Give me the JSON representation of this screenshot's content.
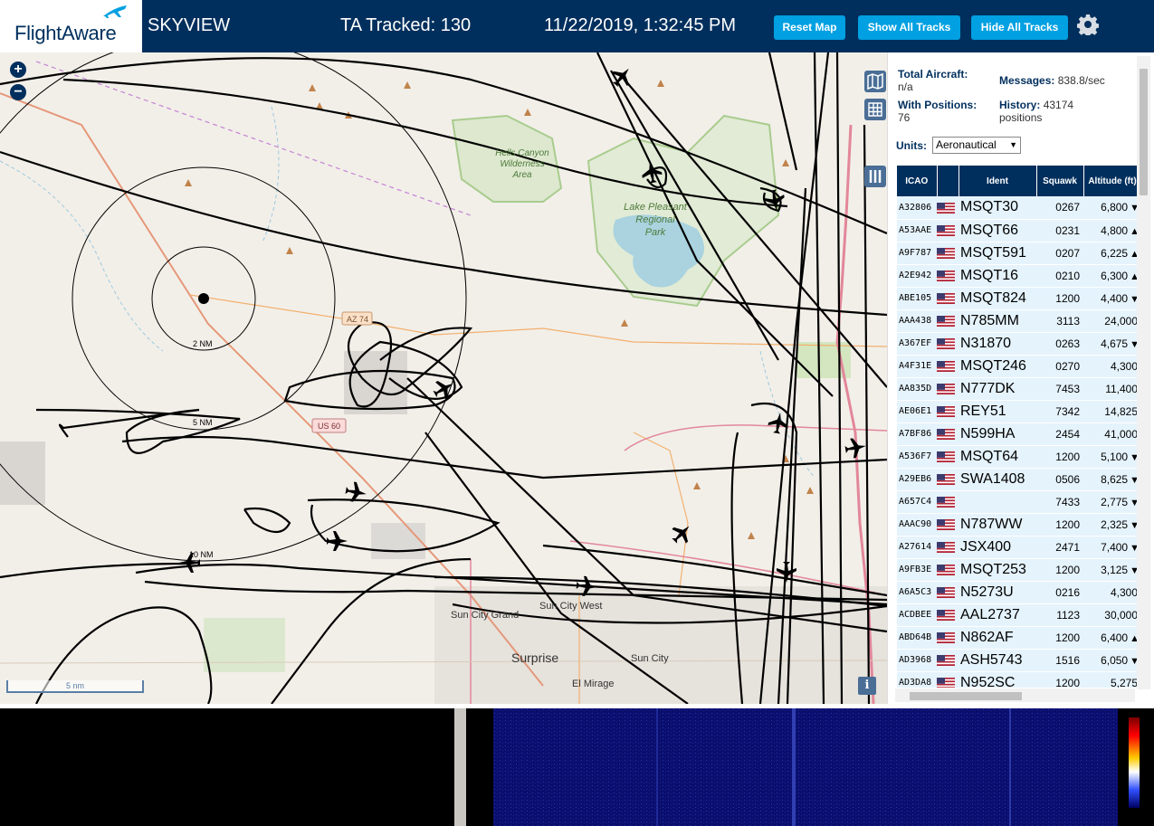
{
  "header": {
    "logo_text": "FlightAware",
    "app_title": "SKYVIEW",
    "tracked": "TA Tracked: 130",
    "timestamp": "11/22/2019, 1:32:45 PM",
    "buttons": {
      "reset": "Reset Map",
      "show_tracks": "Show All Tracks",
      "hide_tracks": "Hide All Tracks"
    }
  },
  "map": {
    "labels": {
      "wilderness": [
        "Hells Canyon",
        "Wilderness",
        "Area"
      ],
      "lake": [
        "Lake Pleasant",
        "Regional",
        "Park"
      ],
      "range_2": "2 NM",
      "range_5": "5 NM",
      "range_10": "10 NM",
      "road_az74": "AZ 74",
      "road_us60": "US 60",
      "sun_city_grand": "Sun City Grand",
      "sun_city_west": "Sun City West",
      "surprise": "Surprise",
      "sun_city": "Sun City",
      "el_mirage": "El Mirage",
      "scale": "5 nm",
      "info": "i"
    }
  },
  "sidebar": {
    "total_aircraft_label": "Total Aircraft:",
    "total_aircraft_value": "n/a",
    "messages_label": "Messages:",
    "messages_value": "838.8/sec",
    "with_positions_label": "With Positions:",
    "with_positions_value": "76",
    "history_label": "History:",
    "history_value": "43174",
    "history_unit": "positions",
    "units_label": "Units:",
    "units_value": "Aeronautical",
    "columns": [
      "ICAO",
      "",
      "Ident",
      "Squawk",
      "Altitude (ft)"
    ],
    "rows": [
      {
        "icao": "A32806",
        "ident": "MSQT30",
        "squawk": "0267",
        "alt": "6,800",
        "trend": "▼"
      },
      {
        "icao": "A53AAE",
        "ident": "MSQT66",
        "squawk": "0231",
        "alt": "4,800",
        "trend": "▲"
      },
      {
        "icao": "A9F787",
        "ident": "MSQT591",
        "squawk": "0207",
        "alt": "6,225",
        "trend": "▲"
      },
      {
        "icao": "A2E942",
        "ident": "MSQT16",
        "squawk": "0210",
        "alt": "6,300",
        "trend": "▲"
      },
      {
        "icao": "ABE105",
        "ident": "MSQT824",
        "squawk": "1200",
        "alt": "4,400",
        "trend": "▼"
      },
      {
        "icao": "AAA438",
        "ident": "N785MM",
        "squawk": "3113",
        "alt": "24,000",
        "trend": ""
      },
      {
        "icao": "A367EF",
        "ident": "N31870",
        "squawk": "0263",
        "alt": "4,675",
        "trend": "▼"
      },
      {
        "icao": "A4F31E",
        "ident": "MSQT246",
        "squawk": "0270",
        "alt": "4,300",
        "trend": ""
      },
      {
        "icao": "AA835D",
        "ident": "N777DK",
        "squawk": "7453",
        "alt": "11,400",
        "trend": ""
      },
      {
        "icao": "AE06E1",
        "ident": "REY51",
        "squawk": "7342",
        "alt": "14,825",
        "trend": ""
      },
      {
        "icao": "A7BF86",
        "ident": "N599HA",
        "squawk": "2454",
        "alt": "41,000",
        "trend": ""
      },
      {
        "icao": "A536F7",
        "ident": "MSQT64",
        "squawk": "1200",
        "alt": "5,100",
        "trend": "▼"
      },
      {
        "icao": "A29EB6",
        "ident": "SWA1408",
        "squawk": "0506",
        "alt": "8,625",
        "trend": "▼"
      },
      {
        "icao": "A657C4",
        "ident": "",
        "squawk": "7433",
        "alt": "2,775",
        "trend": "▼"
      },
      {
        "icao": "AAAC90",
        "ident": "N787WW",
        "squawk": "1200",
        "alt": "2,325",
        "trend": "▼"
      },
      {
        "icao": "A27614",
        "ident": "JSX400",
        "squawk": "2471",
        "alt": "7,400",
        "trend": "▼"
      },
      {
        "icao": "A9FB3E",
        "ident": "MSQT253",
        "squawk": "1200",
        "alt": "3,125",
        "trend": "▼"
      },
      {
        "icao": "A6A5C3",
        "ident": "N5273U",
        "squawk": "0216",
        "alt": "4,300",
        "trend": ""
      },
      {
        "icao": "ACDBEE",
        "ident": "AAL2737",
        "squawk": "1123",
        "alt": "30,000",
        "trend": ""
      },
      {
        "icao": "ABD64B",
        "ident": "N862AF",
        "squawk": "1200",
        "alt": "6,400",
        "trend": "▲"
      },
      {
        "icao": "AD3968",
        "ident": "ASH5743",
        "squawk": "1516",
        "alt": "6,050",
        "trend": "▼"
      },
      {
        "icao": "AD3DA8",
        "ident": "N952SC",
        "squawk": "1200",
        "alt": "5,275",
        "trend": ""
      }
    ]
  },
  "colors": {
    "header_bg": "#002f5d",
    "button_bg": "#00a0e2",
    "row_bg": "#e5f3fc",
    "track": "#000000",
    "map_bg": "#f2efe9"
  }
}
